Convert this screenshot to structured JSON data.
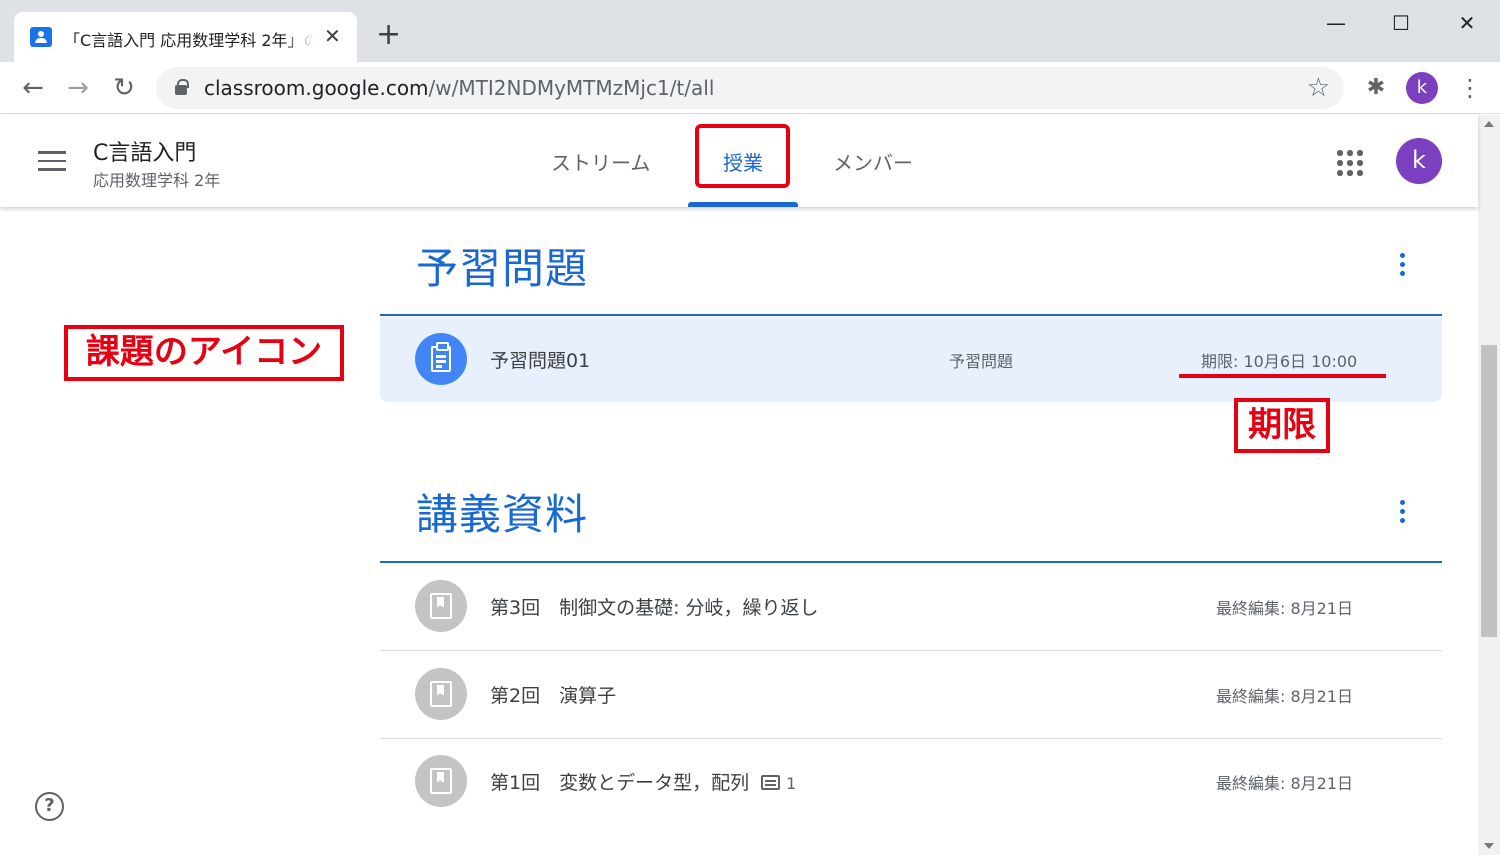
{
  "browser": {
    "tab_title": "「C言語入門 応用数理学科 2年」の",
    "tab_close": "✕",
    "new_tab": "+",
    "url_host": "classroom.google.com",
    "url_path": "/w/MTI2NDMyMTMzMjc1/t/all",
    "profile_initial": "k",
    "window_controls": {
      "minimize": "—",
      "maximize": "☐",
      "close": "✕"
    }
  },
  "header": {
    "class_name": "C言語入門",
    "class_section": "応用数理学科 2年",
    "tabs": [
      {
        "label": "ストリーム",
        "active": false
      },
      {
        "label": "授業",
        "active": true
      },
      {
        "label": "メンバー",
        "active": false
      }
    ],
    "avatar_initial": "k"
  },
  "topics": [
    {
      "title": "予習問題",
      "items": [
        {
          "type": "assignment",
          "title": "予習問題01",
          "topic": "予習問題",
          "meta": "期限: 10月6日 10:00"
        }
      ]
    },
    {
      "title": "講義資料",
      "items": [
        {
          "type": "material",
          "title": "第3回　制御文の基礎: 分岐，繰り返し",
          "meta": "最終編集: 8月21日"
        },
        {
          "type": "material",
          "title": "第2回　演算子",
          "meta": "最終編集: 8月21日"
        },
        {
          "type": "material",
          "title": "第1回　変数とデータ型，配列",
          "comment_count": "1",
          "meta": "最終編集: 8月21日"
        }
      ]
    }
  ],
  "annotations": {
    "assignment_icon_label": "課題のアイコン",
    "due_label": "期限"
  },
  "colors": {
    "accent": "#1967d2",
    "assignment_bg": "#e8f0fe",
    "annotation_red": "#e60012",
    "avatar_purple": "#7b3fc0"
  },
  "icons": [
    "classroom-favicon",
    "back-arrow-icon",
    "forward-arrow-icon",
    "reload-icon",
    "lock-icon",
    "star-icon",
    "extensions-icon",
    "kebab-menu-icon",
    "hamburger-icon",
    "apps-grid-icon",
    "assignment-icon",
    "material-icon",
    "comment-icon",
    "help-icon"
  ]
}
